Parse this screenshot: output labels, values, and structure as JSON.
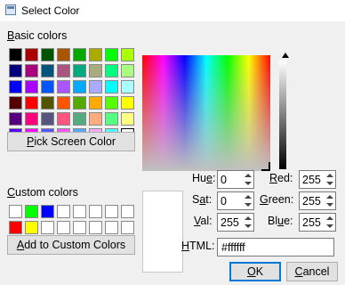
{
  "window": {
    "title": "Select Color"
  },
  "basic_colors": {
    "label": "Basic colors",
    "swatches": [
      "#000000",
      "#aa0000",
      "#005500",
      "#aa5500",
      "#00aa00",
      "#aaaa00",
      "#00ff00",
      "#aaff00",
      "#00007f",
      "#aa007f",
      "#00557f",
      "#aa557f",
      "#00aa7f",
      "#aaaa7f",
      "#00ff7f",
      "#aaff7f",
      "#0000ff",
      "#aa00ff",
      "#0055ff",
      "#aa55ff",
      "#00aaff",
      "#aaaaff",
      "#00ffff",
      "#aaffff",
      "#550000",
      "#ff0000",
      "#555500",
      "#ff5500",
      "#55aa00",
      "#ffaa00",
      "#55ff00",
      "#ffff00",
      "#55007f",
      "#ff007f",
      "#55557f",
      "#ff557f",
      "#55aa7f",
      "#ffaa7f",
      "#55ff7f",
      "#ffff7f",
      "#5500ff",
      "#ff00ff",
      "#5555ff",
      "#ff55ff",
      "#55aaff",
      "#ffaaff",
      "#55ffff",
      "#ffffff"
    ],
    "selected_index": 47
  },
  "pick_screen_color": {
    "label": "Pick Screen Color"
  },
  "custom_colors": {
    "label": "Custom colors",
    "swatches": [
      "#ffffff",
      "#00ff00",
      "#0000ff",
      "#ffffff",
      "#ffffff",
      "#ffffff",
      "#ffffff",
      "#ffffff",
      "#ff0000",
      "#ffff00",
      "#ffffff",
      "#ffffff",
      "#ffffff",
      "#ffffff",
      "#ffffff",
      "#ffffff"
    ]
  },
  "add_custom": {
    "label": "Add to Custom Colors"
  },
  "fields": {
    "hue": {
      "label": "Hue:",
      "value": "0"
    },
    "sat": {
      "label": "Sat:",
      "value": "0"
    },
    "val": {
      "label": "Val:",
      "value": "255"
    },
    "red": {
      "label": "Red:",
      "value": "255"
    },
    "green": {
      "label": "Green:",
      "value": "255"
    },
    "blue": {
      "label": "Blue:",
      "value": "255"
    },
    "html": {
      "label": "HTML:",
      "value": "#ffffff"
    }
  },
  "buttons": {
    "ok": "OK",
    "cancel": "Cancel"
  },
  "current_color": "#ffffff"
}
